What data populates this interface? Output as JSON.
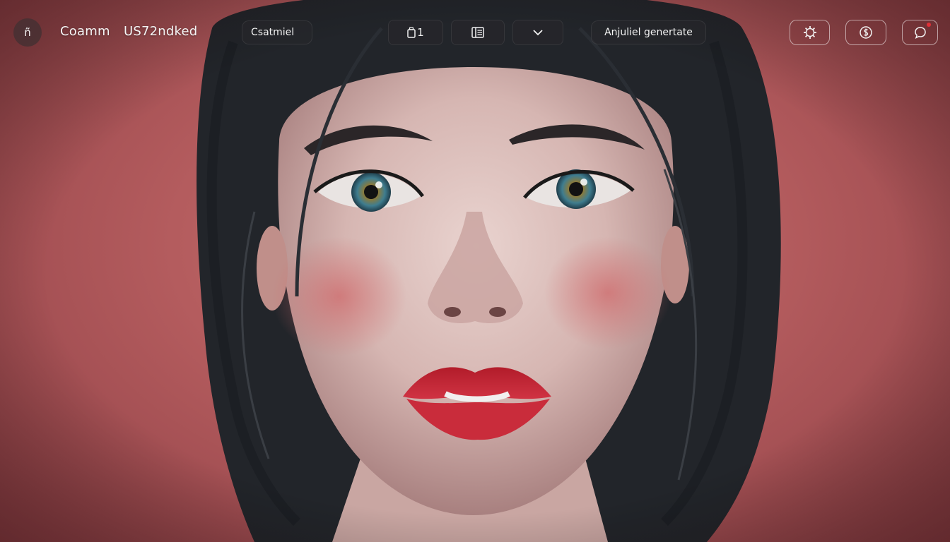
{
  "header": {
    "menu_glyph": "ñ",
    "brand_name": "Coamm",
    "brand_status": "US72ndked",
    "custom_label": "Csatmiel",
    "clip_count": "1",
    "generate_label": "Anjuliel genertate"
  },
  "icons": {
    "menu": "menu-icon",
    "clip": "clip-icon",
    "layout": "layout-icon",
    "expand": "chevron-down-icon",
    "settings": "gear-icon",
    "credits": "coin-icon",
    "chat": "chat-icon"
  },
  "colors": {
    "background": "#b45c5e",
    "notification": "#e03038",
    "lips": "#c4232f"
  }
}
